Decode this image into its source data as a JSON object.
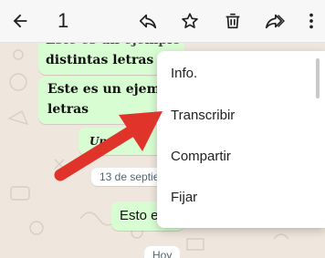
{
  "topbar": {
    "selected_count": "1",
    "icons": [
      "back-arrow-icon",
      "reply-icon",
      "star-icon",
      "delete-icon",
      "forward-icon",
      "more-vert-icon"
    ]
  },
  "chat": {
    "messages": [
      {
        "line1": "Este es un ejemplo",
        "line2": "distintas letras"
      },
      {
        "line1": "Este es un ejemplo",
        "line2": "letras"
      },
      {
        "line1": "Un"
      }
    ],
    "date_divider_1": "13 de septie",
    "partial_message": "Esto e",
    "date_divider_2": "Hoy"
  },
  "menu": {
    "items": [
      {
        "label": "Info."
      },
      {
        "label": "Transcribir"
      },
      {
        "label": "Compartir"
      },
      {
        "label": "Fijar"
      }
    ]
  },
  "colors": {
    "bubble": "#d9fdd3",
    "background": "#efe7dd",
    "arrow": "#e0342a"
  }
}
